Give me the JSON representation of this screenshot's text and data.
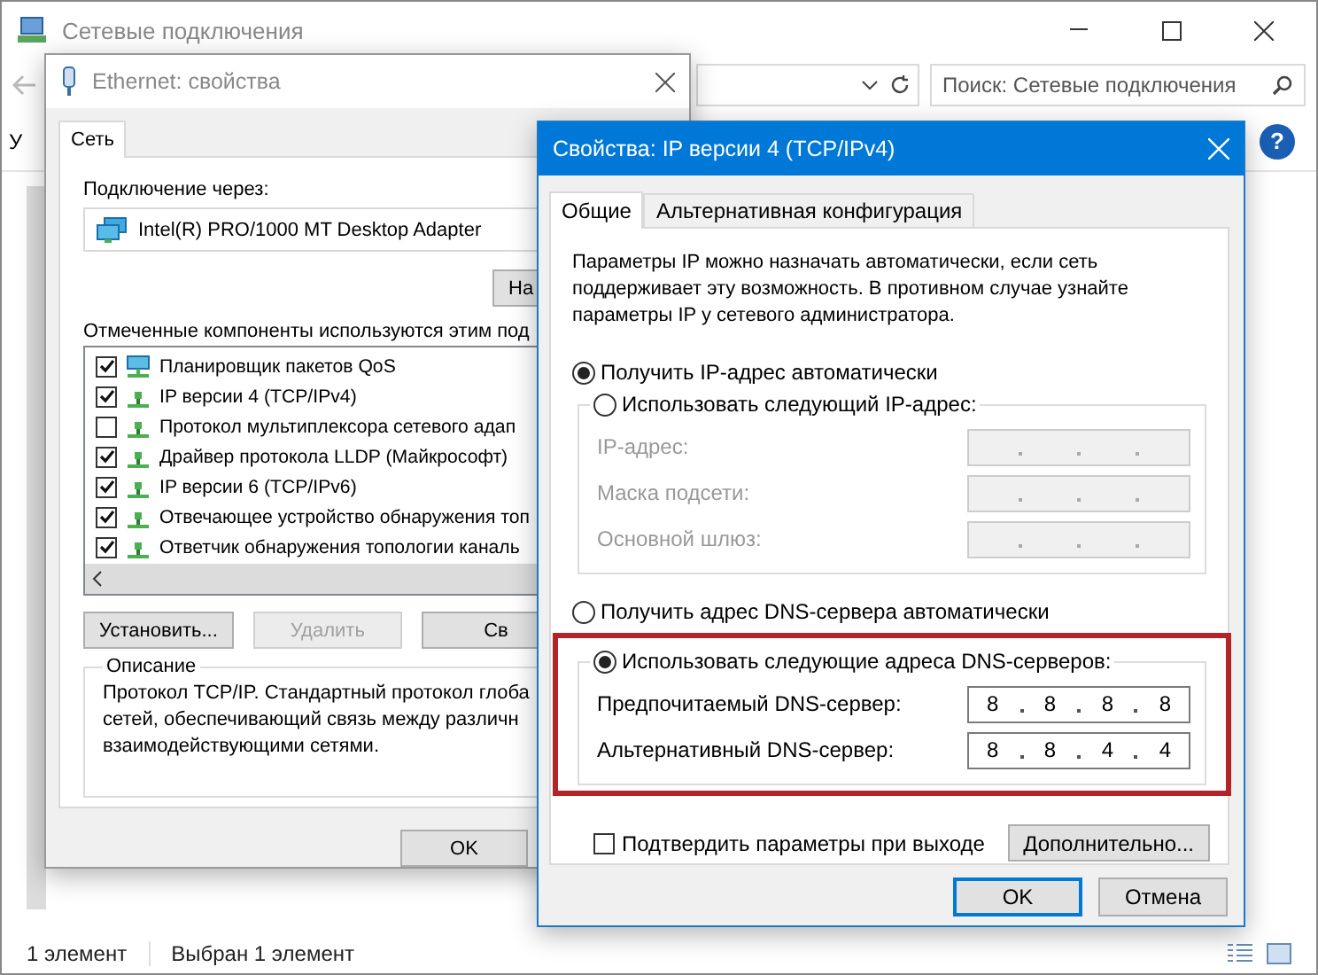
{
  "explorer": {
    "title": "Сетевые подключения",
    "toolbar_fragment": "У",
    "search": {
      "placeholder": "Поиск: Сетевые подключения"
    },
    "help_button": "?",
    "status_bar": [
      "1 элемент",
      "Выбран 1 элемент"
    ]
  },
  "ethernet_dialog": {
    "title": "Ethernet: свойства",
    "tabs": [
      {
        "label": "Сеть",
        "selected": true
      }
    ],
    "connect_using_label": "Подключение через:",
    "adapter": "Intel(R) PRO/1000 MT Desktop Adapter",
    "configure_button": "На",
    "components_label": "Отмеченные компоненты используются этим под",
    "components": [
      {
        "kind": "service",
        "label": "Планировщик пакетов QoS",
        "checked": true
      },
      {
        "kind": "protocol",
        "label": "IP версии 4 (TCP/IPv4)",
        "checked": true
      },
      {
        "kind": "protocol",
        "label": "Протокол мультиплексора сетевого адап",
        "checked": false
      },
      {
        "kind": "protocol",
        "label": "Драйвер протокола LLDP (Майкрософт)",
        "checked": true
      },
      {
        "kind": "protocol",
        "label": "IP версии 6 (TCP/IPv6)",
        "checked": true
      },
      {
        "kind": "protocol",
        "label": "Отвечающее устройство обнаружения топ",
        "checked": true
      },
      {
        "kind": "protocol",
        "label": "Ответчик обнаружения топологии каналь",
        "checked": true
      }
    ],
    "buttons": [
      {
        "label": "Установить...",
        "disabled": false
      },
      {
        "label": "Удалить",
        "disabled": true
      },
      {
        "label": "Св",
        "disabled": false
      }
    ],
    "description": {
      "title": "Описание",
      "lines": [
        "Протокол TCP/IP. Стандартный протокол глоба",
        "сетей, обеспечивающий связь между различн",
        "взаимодействующими сетями."
      ]
    },
    "ok_button": "OK"
  },
  "ipv4_dialog": {
    "title": "Свойства: IP версии 4 (TCP/IPv4)",
    "tabs": [
      {
        "label": "Общие",
        "selected": true
      },
      {
        "label": "Альтернативная конфигурация",
        "selected": false
      }
    ],
    "intro": "Параметры IP можно назначать автоматически, если сеть поддерживает эту возможность. В противном случае узнайте параметры IP у сетевого администратора.",
    "ip_mode": [
      {
        "label": "Получить IP-адрес автоматически",
        "selected": true
      },
      {
        "label": "Использовать следующий IP-адрес:",
        "selected": false
      }
    ],
    "ip_fields": [
      {
        "label": "IP-адрес:",
        "disabled": true
      },
      {
        "label": "Маска подсети:",
        "disabled": true
      },
      {
        "label": "Основной шлюз:",
        "disabled": true
      }
    ],
    "dns_mode": [
      {
        "label": "Получить адрес DNS-сервера автоматически",
        "selected": false
      },
      {
        "label": "Использовать следующие адреса DNS-серверов:",
        "selected": true
      }
    ],
    "dns_highlighted": true,
    "dns_fields": [
      {
        "label": "Предпочитаемый DNS-сервер:",
        "disabled": false,
        "octets": [
          "8",
          "8",
          "8",
          "8"
        ]
      },
      {
        "label": "Альтернативный DNS-сервер:",
        "disabled": false,
        "octets": [
          "8",
          "8",
          "4",
          "4"
        ]
      }
    ],
    "validate": {
      "label": "Подтвердить параметры при выходе",
      "checked": false
    },
    "advanced_button": "Дополнительно...",
    "buttons": [
      {
        "label": "OK",
        "default": true
      },
      {
        "label": "Отмена",
        "default": false
      }
    ]
  }
}
